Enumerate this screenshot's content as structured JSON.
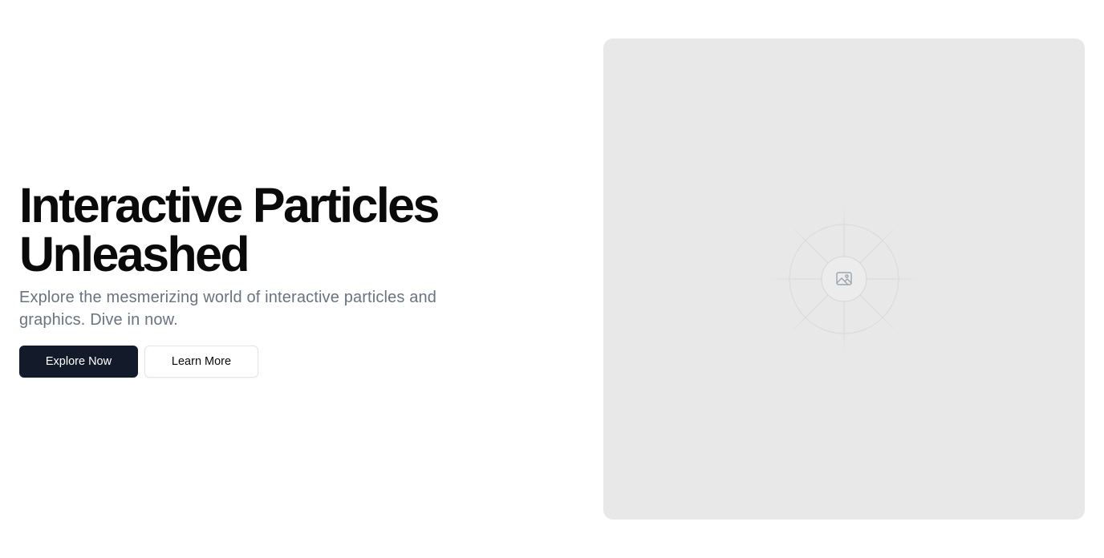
{
  "hero": {
    "headline_line1": "Interactive Particles",
    "headline_line2": "Unleashed",
    "subtitle": "Explore the mesmerizing world of interactive particles and graphics. Dive in now.",
    "primary_button_label": "Explore Now",
    "secondary_button_label": "Learn More"
  },
  "media": {
    "icon": "image-icon"
  },
  "colors": {
    "primary_button_bg": "#131a29",
    "headline": "#0a0a0a",
    "subtitle": "#6b7280",
    "placeholder_bg": "#e8e8e8"
  }
}
